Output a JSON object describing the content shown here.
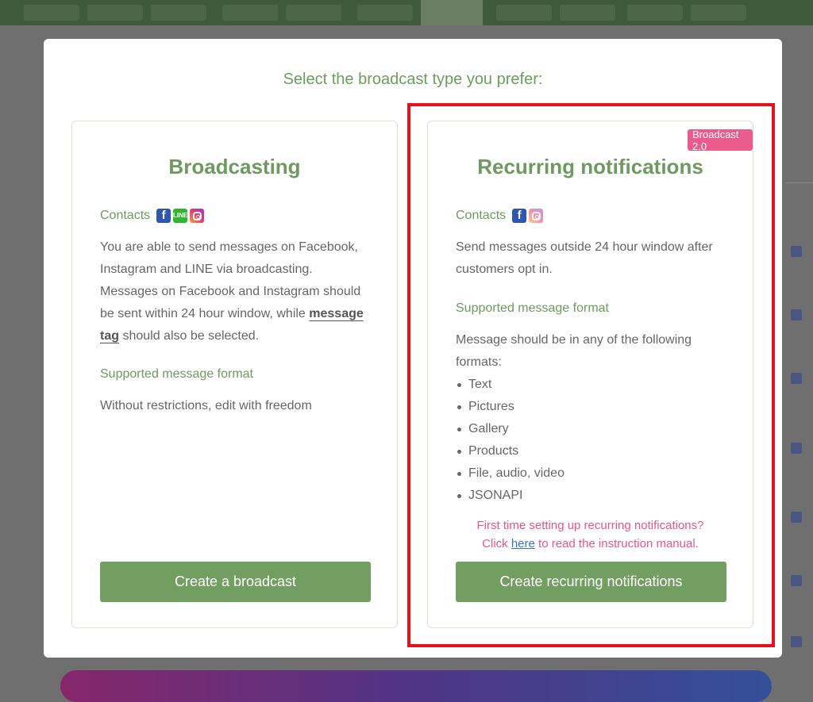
{
  "modal": {
    "title": "Select the broadcast type you prefer:"
  },
  "broadcasting_card": {
    "title": "Broadcasting",
    "contacts_label": "Contacts",
    "channels": [
      "facebook-icon",
      "line-icon",
      "instagram-icon"
    ],
    "description_before": "You are able to send messages on Facebook, Instagram and LINE via broadcasting. Messages on Facebook and Instagram should be sent within 24 hour window, while ",
    "description_link": "message tag",
    "description_after": " should also be selected.",
    "format_label": "Supported message format",
    "format_text": "Without restrictions, edit with freedom",
    "button_label": "Create a broadcast"
  },
  "recurring_card": {
    "badge": "Broadcast 2.0",
    "title": "Recurring notifications",
    "contacts_label": "Contacts",
    "channels": [
      "facebook-icon",
      "instagram-icon"
    ],
    "description": "Send messages outside 24 hour window after customers opt in.",
    "format_label": "Supported message format",
    "format_intro": "Message should be in any of the following formats:",
    "formats": [
      "Text",
      "Pictures",
      "Gallery",
      "Products",
      "File, audio, video",
      "JSONAPI"
    ],
    "note_line1": "First time setting up recurring notifications?",
    "note_prefix": "Click ",
    "note_link": "here",
    "note_suffix": " to read the instruction manual.",
    "button_label": "Create recurring notifications"
  },
  "colors": {
    "accent_green": "#729e62",
    "title_green": "#6e9a5f",
    "badge_pink": "#ea5c8c",
    "note_pink": "#e8568a",
    "highlight_red": "#e8101a",
    "link_blue": "#3a6ed8"
  }
}
